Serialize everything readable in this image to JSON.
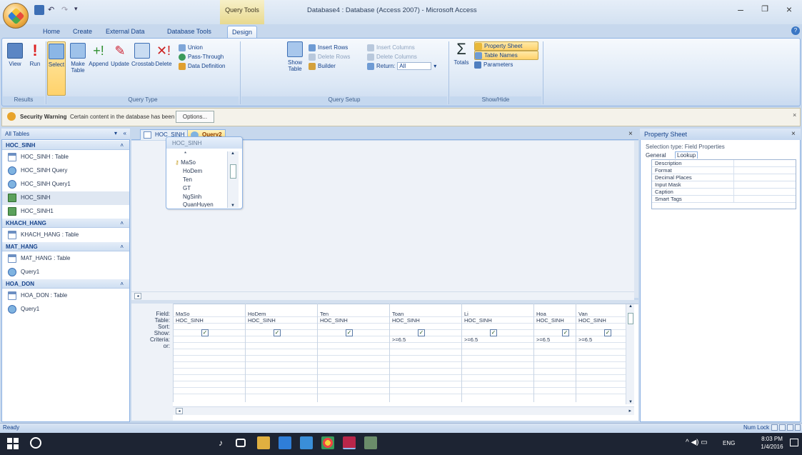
{
  "window": {
    "title": "Database4 : Database (Access 2007) - Microsoft Access",
    "contextual_group": "Query Tools"
  },
  "ribbon_tabs": [
    "Home",
    "Create",
    "External Data",
    "Database Tools",
    "Design"
  ],
  "active_tab": "Design",
  "ribbon": {
    "results": {
      "view": "View",
      "run": "Run",
      "label": "Results"
    },
    "query_type": {
      "select": "Select",
      "make_table": "Make Table",
      "append": "Append",
      "update": "Update",
      "crosstab": "Crosstab",
      "delete": "Delete",
      "union": "Union",
      "pass_through": "Pass-Through",
      "data_definition": "Data Definition",
      "label": "Query Type"
    },
    "query_setup": {
      "show_table": "Show Table",
      "insert_rows": "Insert Rows",
      "delete_rows": "Delete Rows",
      "builder": "Builder",
      "insert_columns": "Insert Columns",
      "delete_columns": "Delete Columns",
      "return_label": "Return:",
      "return_value": "All",
      "label": "Query Setup"
    },
    "show_hide": {
      "totals": "Totals",
      "property_sheet": "Property Sheet",
      "table_names": "Table Names",
      "parameters": "Parameters",
      "label": "Show/Hide"
    }
  },
  "security_bar": {
    "warning_label": "Security Warning",
    "message": "Certain content in the database has been disabled",
    "options_button": "Options..."
  },
  "nav_pane": {
    "header": "All Tables",
    "groups": [
      {
        "name": "HOC_SINH",
        "items": [
          "HOC_SINH : Table",
          "HOC_SINH Query",
          "HOC_SINH Query1",
          "HOC_SINH",
          "HOC_SINH1"
        ]
      },
      {
        "name": "KHACH_HANG",
        "items": [
          "KHACH_HANG : Table"
        ]
      },
      {
        "name": "MAT_HANG",
        "items": [
          "MAT_HANG : Table",
          "Query1"
        ]
      },
      {
        "name": "HOA_DON",
        "items": [
          "HOA_DON : Table",
          "Query1"
        ]
      }
    ]
  },
  "doc_tabs": [
    "HOC_SINH",
    "Query2"
  ],
  "active_doc": "Query2",
  "field_list": {
    "table": "HOC_SINH",
    "fields": [
      "*",
      "MaSo",
      "HoDem",
      "Ten",
      "GT",
      "NgSinh",
      "QuanHuyen"
    ]
  },
  "qbe": {
    "row_labels": [
      "Field:",
      "Table:",
      "Sort:",
      "Show:",
      "Criteria:",
      "or:"
    ],
    "columns": [
      {
        "field": "MaSo",
        "table": "HOC_SINH",
        "show": true,
        "criteria": ""
      },
      {
        "field": "HoDem",
        "table": "HOC_SINH",
        "show": true,
        "criteria": ""
      },
      {
        "field": "Ten",
        "table": "HOC_SINH",
        "show": true,
        "criteria": ""
      },
      {
        "field": "Toan",
        "table": "HOC_SINH",
        "show": true,
        "criteria": ">=6.5"
      },
      {
        "field": "Li",
        "table": "HOC_SINH",
        "show": true,
        "criteria": ">=6.5"
      },
      {
        "field": "Hoa",
        "table": "HOC_SINH",
        "show": true,
        "criteria": ">=6.5"
      },
      {
        "field": "Van",
        "table": "HOC_SINH",
        "show": true,
        "criteria": ">=6.5"
      }
    ]
  },
  "property_sheet": {
    "title": "Property Sheet",
    "selection_type": "Selection type:  Field Properties",
    "tabs": [
      "General",
      "Lookup"
    ],
    "properties": [
      "Description",
      "Format",
      "Decimal Places",
      "Input Mask",
      "Caption",
      "Smart Tags"
    ]
  },
  "status": {
    "text": "Ready",
    "num_lock": "Num Lock"
  },
  "taskbar": {
    "tray": "ENG",
    "time": "8:03 PM",
    "date": "1/4/2016"
  }
}
